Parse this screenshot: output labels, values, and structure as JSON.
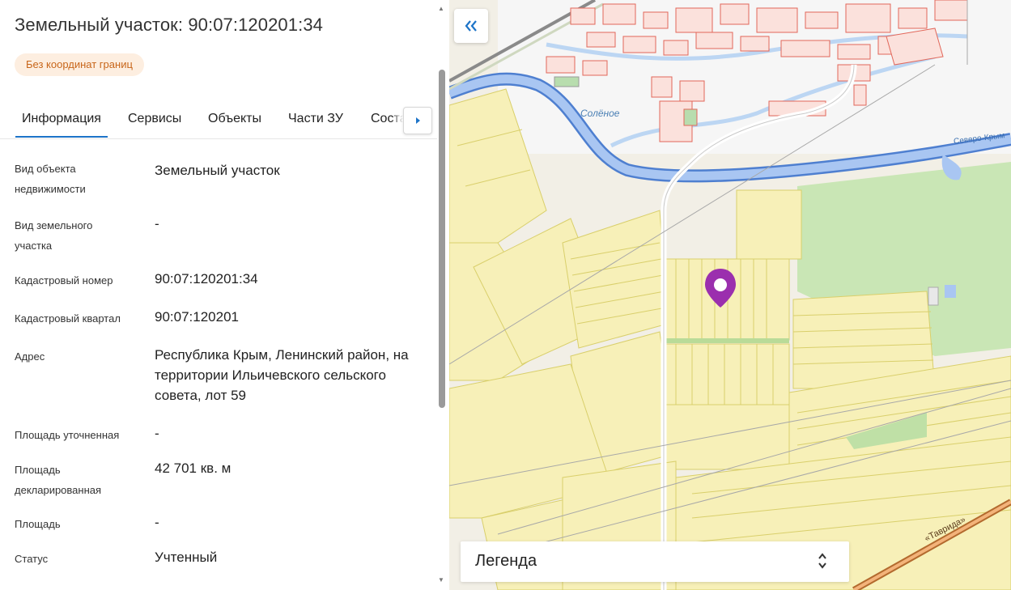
{
  "panel": {
    "title": "Земельный участок: 90:07:120201:34",
    "badge": "Без координат границ",
    "tabs": [
      {
        "label": "Информация",
        "active": true
      },
      {
        "label": "Сервисы",
        "active": false
      },
      {
        "label": "Объекты",
        "active": false
      },
      {
        "label": "Части ЗУ",
        "active": false
      },
      {
        "label": "Соста",
        "active": false
      }
    ],
    "tab_next_icon": "chevron-right-icon",
    "properties": [
      {
        "label": "Вид объекта недвижимости",
        "value": "Земельный участок"
      },
      {
        "label": "Вид земельного участка",
        "value": "-"
      },
      {
        "label": "Кадастровый номер",
        "value": "90:07:120201:34"
      },
      {
        "label": "Кадастровый квартал",
        "value": "90:07:120201"
      },
      {
        "label": "Адрес",
        "value": "Республика Крым, Ленинский район, на территории Ильичевского сельского совета, лот 59"
      },
      {
        "label": "Площадь уточненная",
        "value": "-"
      },
      {
        "label": "Площадь декларированная",
        "value": "42 701 кв. м"
      },
      {
        "label": "Площадь",
        "value": "-"
      },
      {
        "label": "Статус",
        "value": "Учтенный"
      }
    ]
  },
  "map": {
    "collapse_icon": "double-chevron-left-icon",
    "place_label": "Солёное",
    "river_label": "Северо-Крым",
    "road_label": "«Таврида»",
    "legend_label": "Легенда",
    "legend_icon": "chevron-up-down-icon",
    "marker_icon": "location-pin-icon",
    "colors": {
      "accent": "#1d74c8",
      "marker": "#9b2fae",
      "parcel": "#f7f0b8",
      "parcel_stroke": "#d9cf6b",
      "canal": "#7fa8e6",
      "forest": "#c9e6b5"
    }
  }
}
